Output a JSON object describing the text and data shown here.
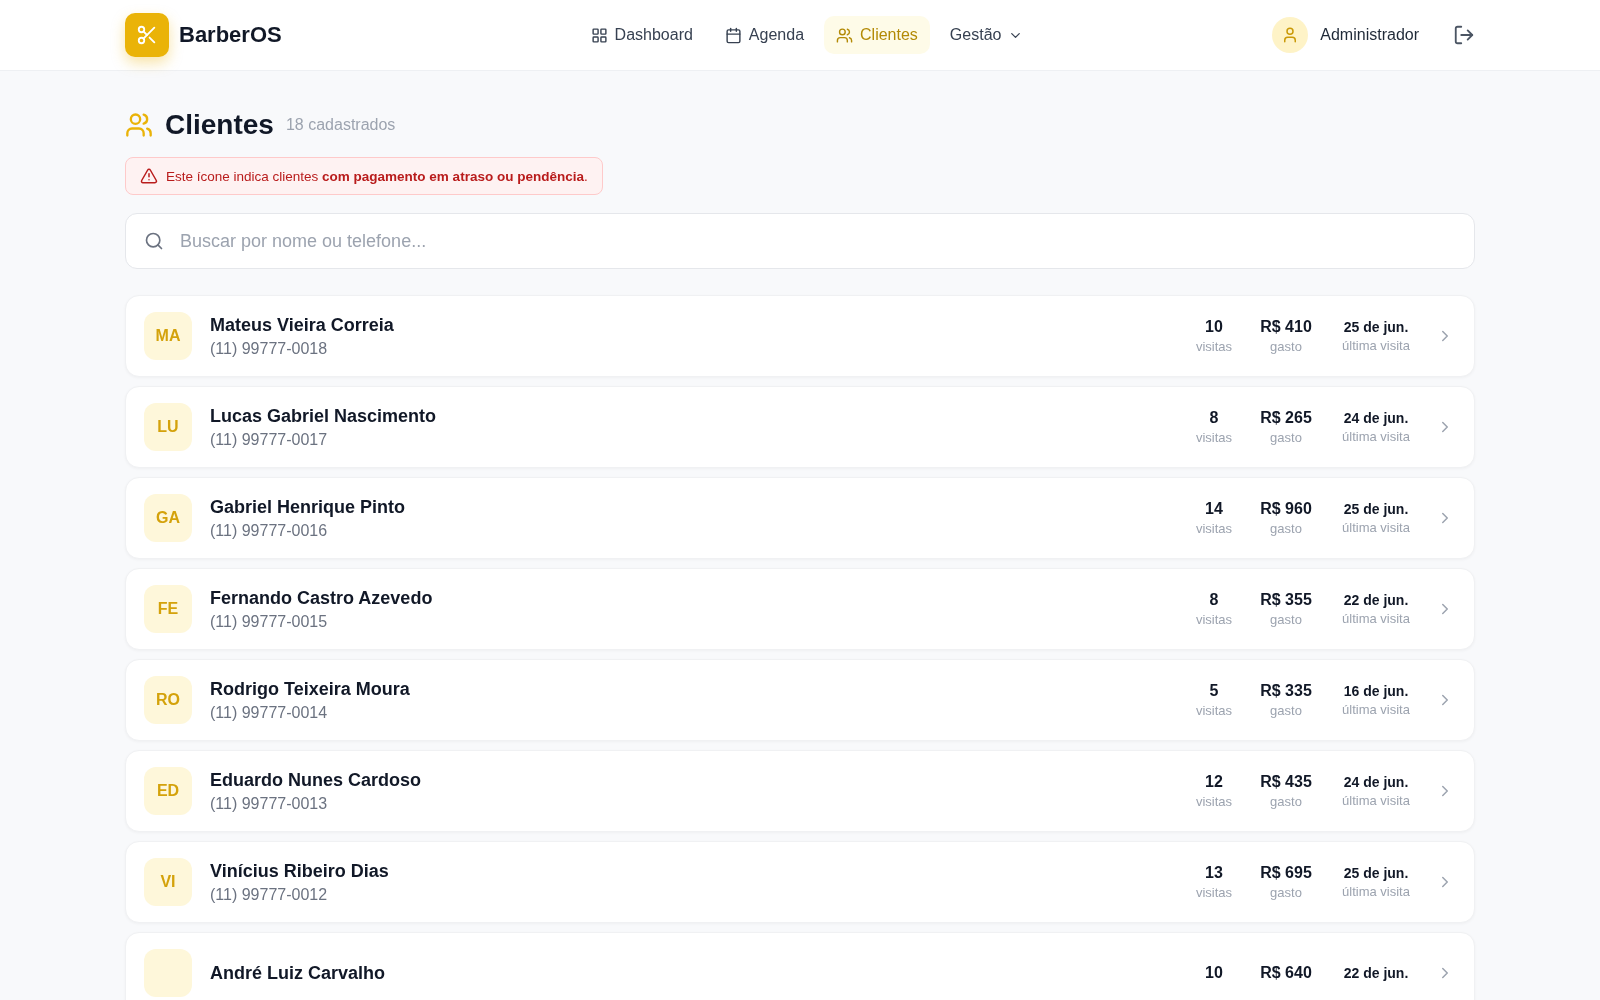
{
  "brand": {
    "name": "BarberOS"
  },
  "nav": [
    {
      "label": "Dashboard",
      "selected": false
    },
    {
      "label": "Agenda",
      "selected": false
    },
    {
      "label": "Clientes",
      "selected": true
    },
    {
      "label": "Gestão",
      "dropdown": true,
      "selected": false
    }
  ],
  "user": {
    "name": "Administrador"
  },
  "page": {
    "title": "Clientes",
    "count": "18 cadastrados"
  },
  "alert": {
    "text": "Este ícone indica clientes **com pagamento em atraso ou pendência**."
  },
  "search": {
    "placeholder": "Buscar por nome ou telefone..."
  },
  "clients": [
    {
      "initials": "MA",
      "name": "Mateus Vieira Correia",
      "phone": "(11) 99777-0018",
      "visits": "10",
      "visits_label": "visitas",
      "spent": "R$ 410",
      "spent_label": "gasto",
      "last": "25 de jun.",
      "last_label": "última visita"
    },
    {
      "initials": "LU",
      "name": "Lucas Gabriel Nascimento",
      "phone": "(11) 99777-0017",
      "visits": "8",
      "visits_label": "visitas",
      "spent": "R$ 265",
      "spent_label": "gasto",
      "last": "24 de jun.",
      "last_label": "última visita"
    },
    {
      "initials": "GA",
      "name": "Gabriel Henrique Pinto",
      "phone": "(11) 99777-0016",
      "visits": "14",
      "visits_label": "visitas",
      "spent": "R$ 960",
      "spent_label": "gasto",
      "last": "25 de jun.",
      "last_label": "última visita"
    },
    {
      "initials": "FE",
      "name": "Fernando Castro Azevedo",
      "phone": "(11) 99777-0015",
      "visits": "8",
      "visits_label": "visitas",
      "spent": "R$ 355",
      "spent_label": "gasto",
      "last": "22 de jun.",
      "last_label": "última visita"
    },
    {
      "initials": "RO",
      "name": "Rodrigo Teixeira Moura",
      "phone": "(11) 99777-0014",
      "visits": "5",
      "visits_label": "visitas",
      "spent": "R$ 335",
      "spent_label": "gasto",
      "last": "16 de jun.",
      "last_label": "última visita"
    },
    {
      "initials": "ED",
      "name": "Eduardo Nunes Cardoso",
      "phone": "(11) 99777-0013",
      "visits": "12",
      "visits_label": "visitas",
      "spent": "R$ 435",
      "spent_label": "gasto",
      "last": "24 de jun.",
      "last_label": "última visita"
    },
    {
      "initials": "VI",
      "name": "Vinícius Ribeiro Dias",
      "phone": "(11) 99777-0012",
      "visits": "13",
      "visits_label": "visitas",
      "spent": "R$ 695",
      "spent_label": "gasto",
      "last": "25 de jun.",
      "last_label": "última visita"
    },
    {
      "name": "André Luiz Carvalho",
      "visits": "10",
      "spent": "R$ 640",
      "last": "22 de jun."
    }
  ]
}
